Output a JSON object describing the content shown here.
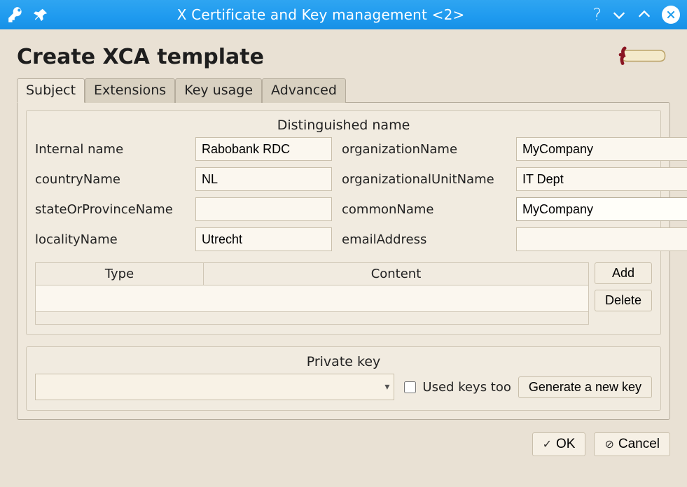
{
  "window": {
    "title": "X Certificate and Key management <2>"
  },
  "page": {
    "heading": "Create XCA template"
  },
  "tabs": {
    "subject": "Subject",
    "extensions": "Extensions",
    "keyusage": "Key usage",
    "advanced": "Advanced"
  },
  "dn": {
    "groupTitle": "Distinguished name",
    "labels": {
      "internalName": "Internal name",
      "countryName": "countryName",
      "state": "stateOrProvinceName",
      "locality": "localityName",
      "org": "organizationName",
      "ou": "organizationalUnitName",
      "cn": "commonName",
      "email": "emailAddress"
    },
    "values": {
      "internalName": "Rabobank RDC",
      "countryName": "NL",
      "state": "",
      "locality": "Utrecht",
      "org": "MyCompany",
      "ou": "IT Dept",
      "cn": "MyCompany",
      "email": ""
    },
    "table": {
      "col_type": "Type",
      "col_content": "Content",
      "btn_add": "Add",
      "btn_delete": "Delete"
    }
  },
  "pk": {
    "groupTitle": "Private key",
    "usedKeysToo": "Used keys too",
    "generate": "Generate a new key"
  },
  "dialog": {
    "ok": "OK",
    "cancel": "Cancel"
  }
}
